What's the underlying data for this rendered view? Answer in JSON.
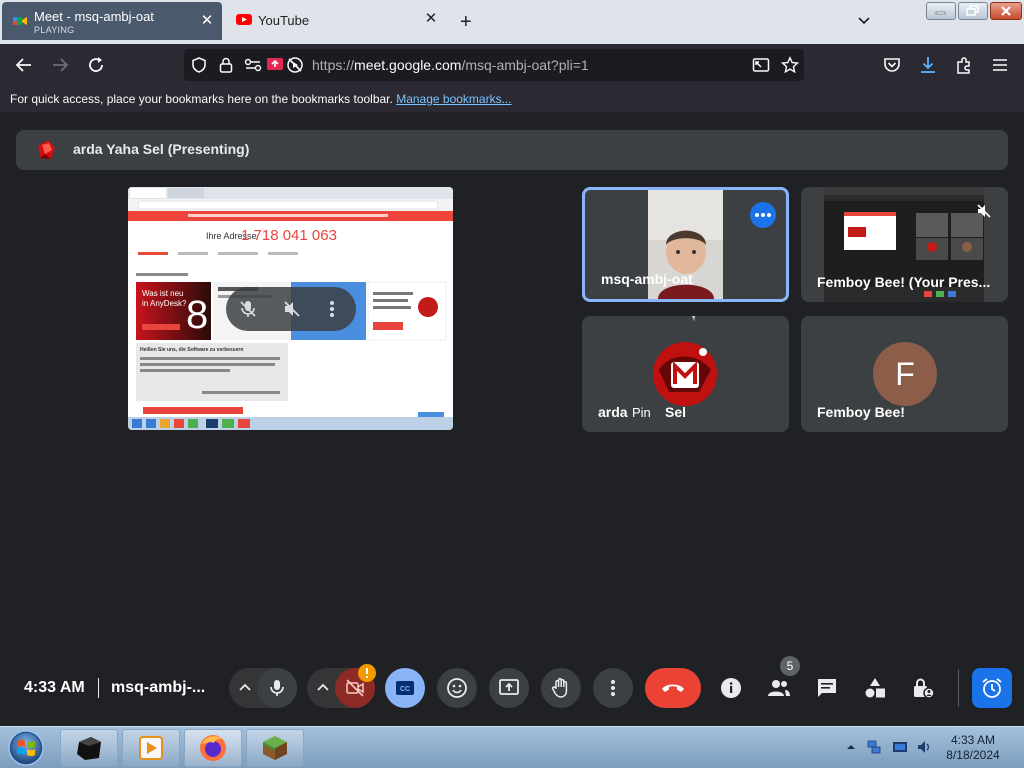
{
  "browser": {
    "tabs": [
      {
        "title": "Meet - msq-ambj-oat",
        "subtitle": "PLAYING",
        "active": true
      },
      {
        "title": "YouTube",
        "active": false
      }
    ],
    "url": {
      "prefix": "https://",
      "domain": "meet.google.com",
      "path": "/msq-ambj-oat?pli=1"
    },
    "bookmarks_bar": {
      "text": "For quick access, place your bookmarks here on the bookmarks toolbar.",
      "link": "Manage bookmarks..."
    }
  },
  "meet": {
    "presenter_bar": {
      "name": "arda Yaha Sel (Presenting)"
    },
    "screen_share": {
      "address_label": "Ihre Adresse",
      "address_number": "1 718 041 063",
      "promo_line1": "Was ist neu",
      "promo_line2": "in AnyDesk?",
      "promo_number": "8",
      "section_heading": "Heißen Sie uns, die Software zu verbessern"
    },
    "tiles": [
      {
        "label": "msq-ambj-oat",
        "highlighted": true
      },
      {
        "label": "Femboy Bee! (Your Pres..."
      },
      {
        "label": "arda",
        "pin_label": "Pin",
        "label2": "Sel"
      },
      {
        "label": "Femboy Bee!",
        "avatar_letter": "F"
      }
    ],
    "controls": {
      "time": "4:33 AM",
      "meeting_code": "msq-ambj-...",
      "people_count": "5"
    }
  },
  "taskbar": {
    "time": "4:33 AM",
    "date": "8/18/2024"
  },
  "colors": {
    "meet_bg": "#202124",
    "tile_bg": "#3c4043",
    "accent_blue": "#8ab4f8",
    "hangup_red": "#ea4335",
    "active_blue": "#1a73e8"
  }
}
